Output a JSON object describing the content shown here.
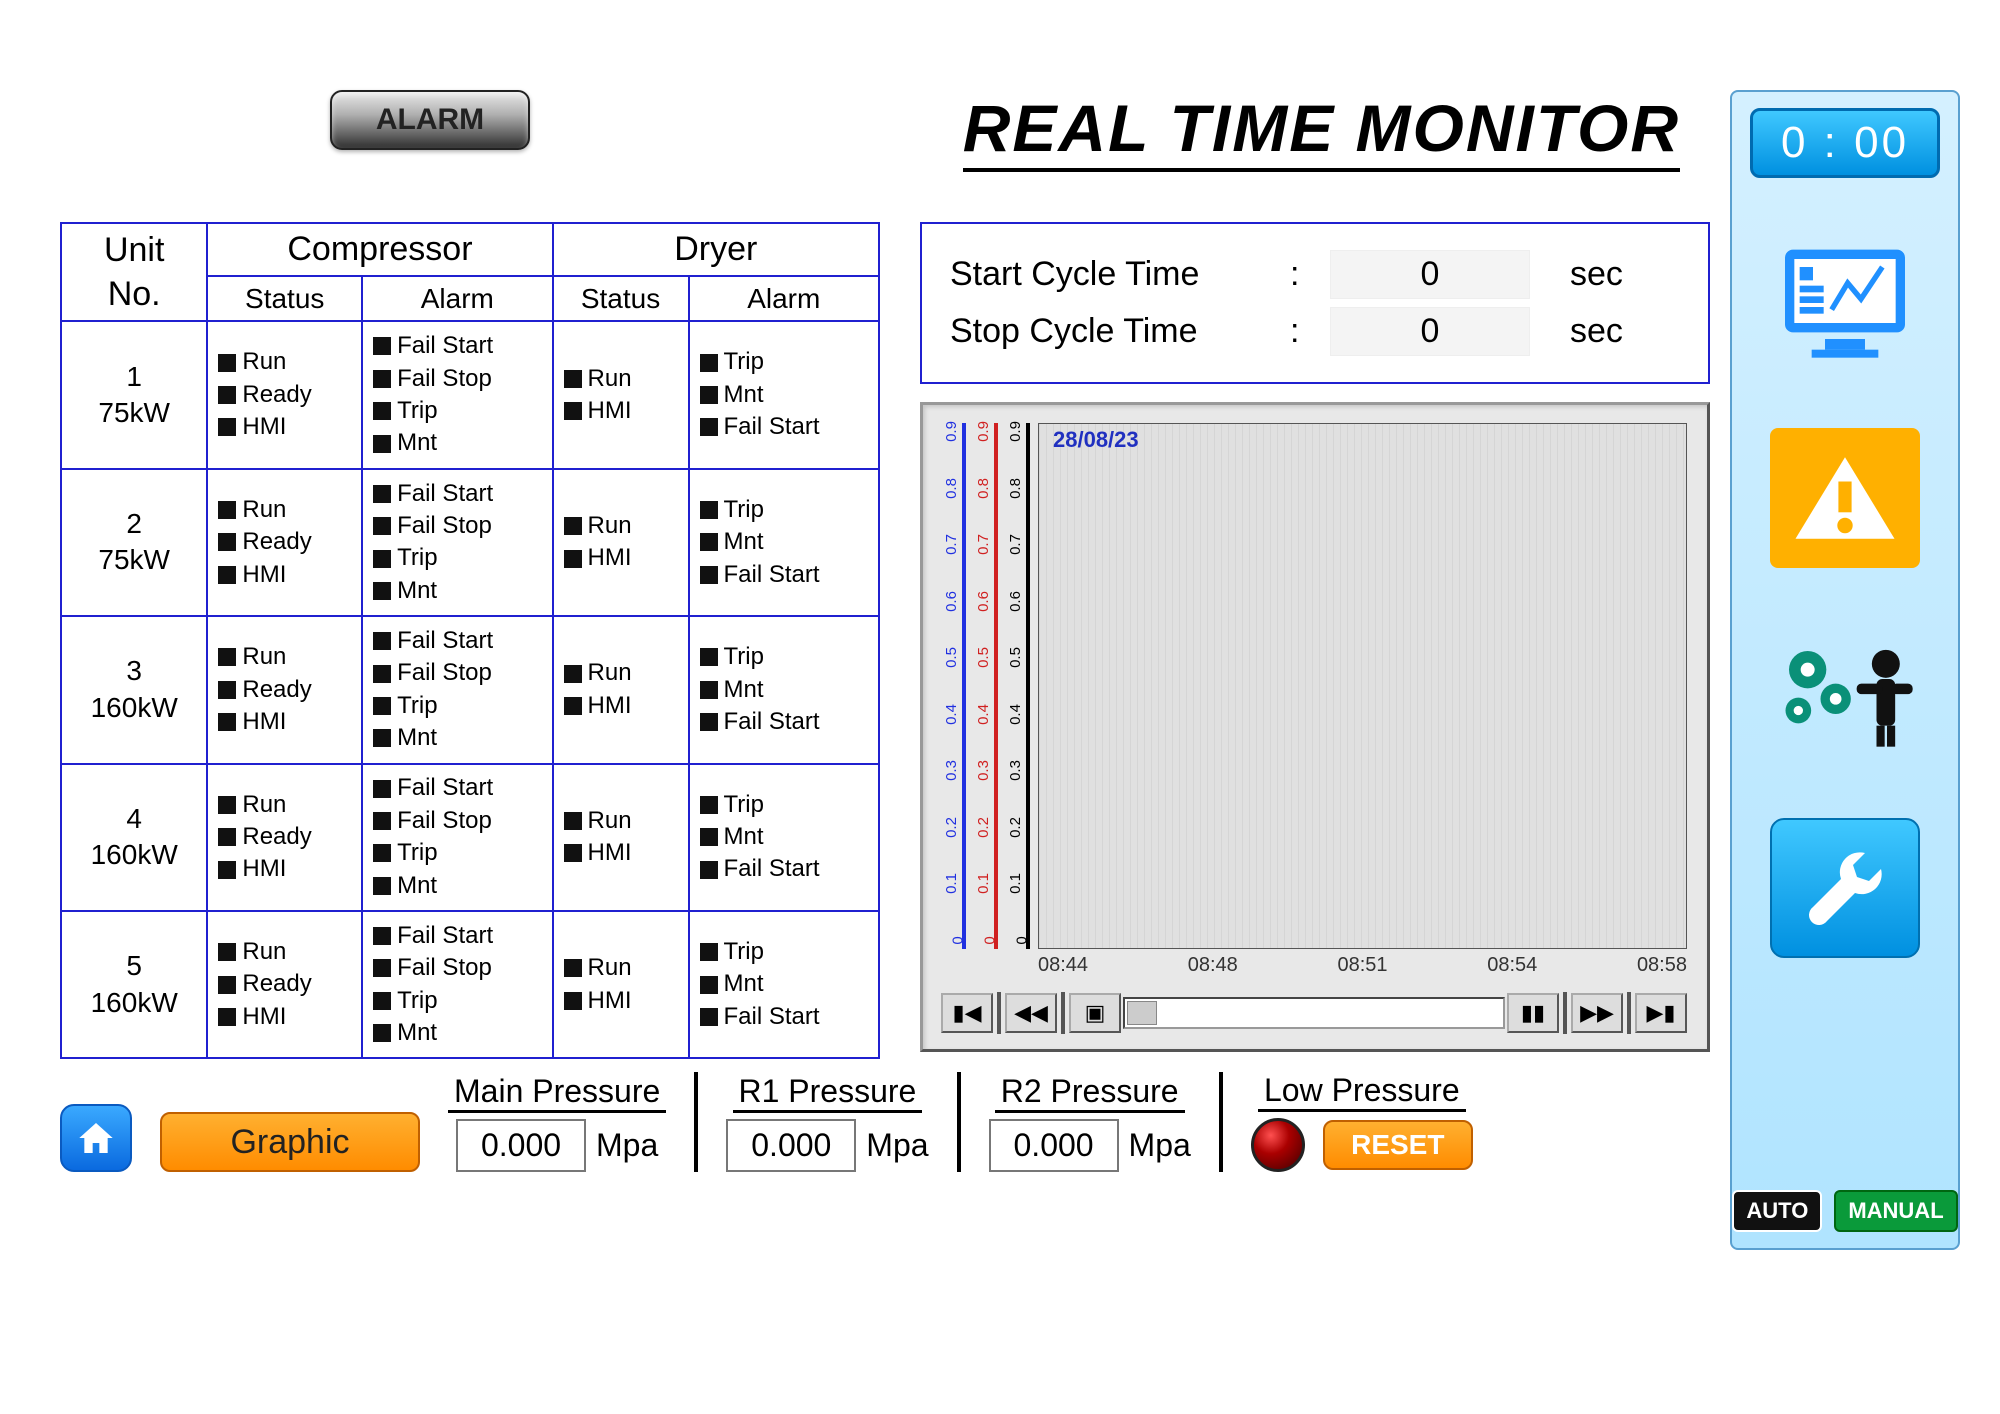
{
  "header": {
    "alarm_btn": "ALARM",
    "page_title": "REAL TIME MONITOR"
  },
  "unit_table": {
    "headers": {
      "unit": "Unit\nNo.",
      "compressor": "Compressor",
      "dryer": "Dryer",
      "status": "Status",
      "alarm": "Alarm"
    },
    "rows": [
      {
        "no": "1",
        "rating": "75kW",
        "comp_status": [
          "Run",
          "Ready",
          "HMI"
        ],
        "comp_alarm": [
          "Fail Start",
          "Fail Stop",
          "Trip",
          "Mnt"
        ],
        "dry_status": [
          "Run",
          "HMI"
        ],
        "dry_alarm": [
          "Trip",
          "Mnt",
          "Fail Start"
        ]
      },
      {
        "no": "2",
        "rating": "75kW",
        "comp_status": [
          "Run",
          "Ready",
          "HMI"
        ],
        "comp_alarm": [
          "Fail Start",
          "Fail Stop",
          "Trip",
          "Mnt"
        ],
        "dry_status": [
          "Run",
          "HMI"
        ],
        "dry_alarm": [
          "Trip",
          "Mnt",
          "Fail Start"
        ]
      },
      {
        "no": "3",
        "rating": "160kW",
        "comp_status": [
          "Run",
          "Ready",
          "HMI"
        ],
        "comp_alarm": [
          "Fail Start",
          "Fail Stop",
          "Trip",
          "Mnt"
        ],
        "dry_status": [
          "Run",
          "HMI"
        ],
        "dry_alarm": [
          "Trip",
          "Mnt",
          "Fail Start"
        ]
      },
      {
        "no": "4",
        "rating": "160kW",
        "comp_status": [
          "Run",
          "Ready",
          "HMI"
        ],
        "comp_alarm": [
          "Fail Start",
          "Fail Stop",
          "Trip",
          "Mnt"
        ],
        "dry_status": [
          "Run",
          "HMI"
        ],
        "dry_alarm": [
          "Trip",
          "Mnt",
          "Fail Start"
        ]
      },
      {
        "no": "5",
        "rating": "160kW",
        "comp_status": [
          "Run",
          "Ready",
          "HMI"
        ],
        "comp_alarm": [
          "Fail Start",
          "Fail Stop",
          "Trip",
          "Mnt"
        ],
        "dry_status": [
          "Run",
          "HMI"
        ],
        "dry_alarm": [
          "Trip",
          "Mnt",
          "Fail Start"
        ]
      }
    ]
  },
  "cycle": {
    "start_label": "Start Cycle Time",
    "start_value": "0",
    "stop_label": "Stop Cycle Time",
    "stop_value": "0",
    "unit": "sec"
  },
  "chart_data": {
    "type": "line",
    "date": "28/08/23",
    "x_ticks": [
      "08:44",
      "08:48",
      "08:51",
      "08:54",
      "08:58"
    ],
    "y_ticks": [
      "0",
      "0.1",
      "0.2",
      "0.3",
      "0.4",
      "0.5",
      "0.6",
      "0.7",
      "0.8",
      "0.9"
    ],
    "series": [
      {
        "name": "R2 Pressure",
        "color": "#2030e0",
        "values": []
      },
      {
        "name": "R1 Pressure",
        "color": "#d02020",
        "values": []
      },
      {
        "name": "Main Pressure",
        "color": "#000000",
        "values": []
      }
    ],
    "ylim": [
      0,
      0.9
    ]
  },
  "pressures": {
    "main": {
      "label": "Main Pressure",
      "value": "0.000",
      "unit": "Mpa"
    },
    "r1": {
      "label": "R1 Pressure",
      "value": "0.000",
      "unit": "Mpa"
    },
    "r2": {
      "label": "R2 Pressure",
      "value": "0.000",
      "unit": "Mpa"
    },
    "low": {
      "label": "Low Pressure",
      "reset": "RESET"
    }
  },
  "bottom": {
    "graphic_btn": "Graphic"
  },
  "sidebar": {
    "clock": "0 : 00",
    "mode_auto": "AUTO",
    "mode_manual": "MANUAL"
  }
}
